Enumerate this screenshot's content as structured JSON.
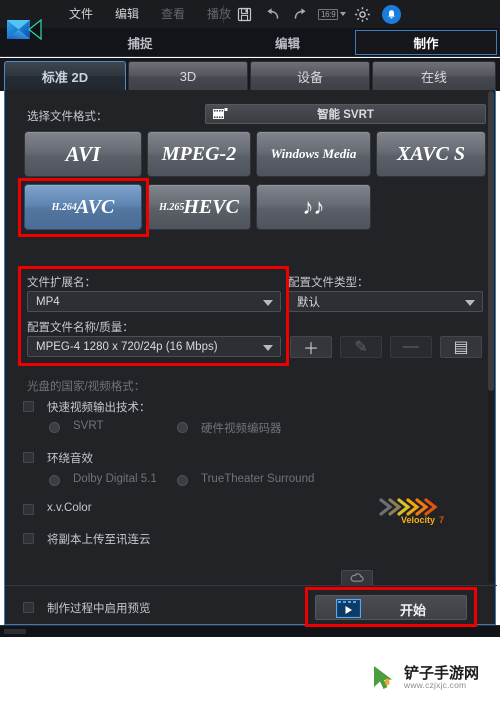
{
  "menubar": {
    "items": [
      {
        "label": "文件",
        "enabled": true
      },
      {
        "label": "编辑",
        "enabled": true
      },
      {
        "label": "查看",
        "enabled": false
      },
      {
        "label": "播放",
        "enabled": false
      }
    ],
    "icons": [
      "save-icon",
      "undo-icon",
      "redo-icon",
      "aspect-ratio-icon",
      "settings-gear-icon",
      "notification-bell-icon"
    ],
    "aspect_ratio": "16:9"
  },
  "modules": [
    {
      "label": "捕捉",
      "active": false
    },
    {
      "label": "编辑",
      "active": false
    },
    {
      "label": "制作",
      "active": true
    }
  ],
  "format_tabs": [
    {
      "label": "标准 2D",
      "active": true
    },
    {
      "label": "3D",
      "active": false
    },
    {
      "label": "设备",
      "active": false
    },
    {
      "label": "在线",
      "active": false
    }
  ],
  "panel": {
    "select_format_label": "选择文件格式：",
    "svrt": {
      "label": "智能 SVRT",
      "icon": "svrt-icon"
    },
    "format_buttons": [
      {
        "id": "avi",
        "label": "AVI",
        "selected": false
      },
      {
        "id": "mpeg2",
        "label": "MPEG-2",
        "selected": false
      },
      {
        "id": "wm",
        "label": "Windows Media",
        "selected": false
      },
      {
        "id": "xavcs",
        "label": "XAVC S",
        "selected": false
      },
      {
        "id": "avc",
        "sup": "H.264",
        "label": "AVC",
        "selected": true
      },
      {
        "id": "hevc",
        "sup": "H.265",
        "label": "HEVC",
        "selected": false
      },
      {
        "id": "audio",
        "label": "♪♪",
        "selected": false
      }
    ],
    "file_extension_label": "文件扩展名：",
    "file_extension_value": "MP4",
    "profile_type_label": "配置文件类型：",
    "profile_type_value": "默认",
    "profile_name_label": "配置文件名称/质量：",
    "profile_name_value": "MPEG-4 1280 x 720/24p (16 Mbps)",
    "profile_buttons": [
      {
        "id": "add",
        "glyph": "＋",
        "enabled": true
      },
      {
        "id": "edit",
        "glyph": "✎",
        "enabled": false
      },
      {
        "id": "remove",
        "glyph": "—",
        "enabled": false
      },
      {
        "id": "list",
        "glyph": "▤",
        "enabled": true
      }
    ],
    "disc_format_label": "光盘的国家/视频格式：",
    "fast_video_label": "快速视频输出技术：",
    "svrt_radio_label": "SVRT",
    "hw_encoder_radio_label": "硬件视频编码器",
    "velocity_label": "Velocity 7",
    "surround_label": "环绕音效",
    "dolby_label": "Dolby Digital 5.1",
    "truetheater_label": "TrueTheater Surround",
    "xvcolor_label": "x.v.Color",
    "upload_label": "将副本上传至讯连云",
    "preview_label": "制作过程中启用预览",
    "start_label": "开始"
  },
  "colors": {
    "accent_blue": "#3a7ab5",
    "highlight_red": "#ee0000",
    "panel_bg": "#222327",
    "selected_button": "#5f86b4"
  },
  "watermark": {
    "name": "铲子手游网",
    "url": "www.czjxjc.com"
  }
}
